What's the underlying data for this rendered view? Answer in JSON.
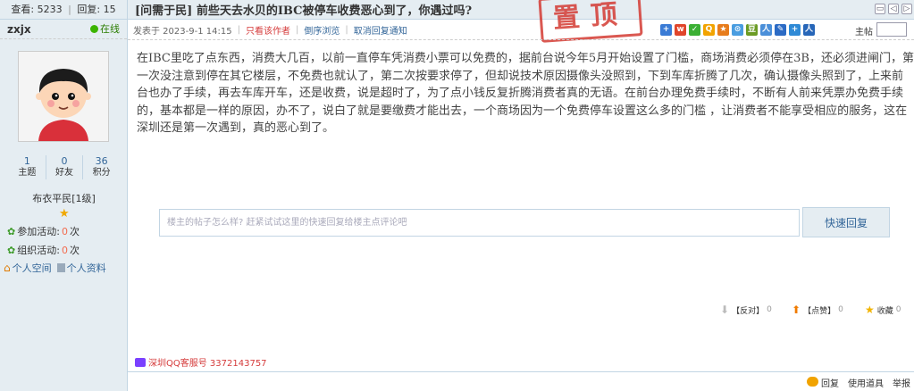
{
  "stats": {
    "views_label": "查看:",
    "views": "5233",
    "replies_label": "回复:",
    "replies": "15"
  },
  "author": {
    "name": "zxjx",
    "status": "在线"
  },
  "counts": [
    {
      "value": "1",
      "label": "主题"
    },
    {
      "value": "0",
      "label": "好友"
    },
    {
      "value": "36",
      "label": "积分"
    }
  ],
  "rank": "布衣平民[1级]",
  "activities": [
    {
      "label": "参加活动:",
      "count": "0",
      "unit": "次"
    },
    {
      "label": "组织活动:",
      "count": "0",
      "unit": "次"
    }
  ],
  "profile_links": {
    "space": "个人空间",
    "profile": "个人资料"
  },
  "post": {
    "title": "[问需于民] 前些天去水贝的IBC被停车收费恶心到了，你遇过吗?",
    "stamp": "置顶",
    "posted": "发表于 2023-9-1 14:15",
    "only_author": "只看该作者",
    "reverse": "倒序浏览",
    "cancel_notify": "取消回复通知",
    "font_label": "主帖",
    "body": "在IBC里吃了点东西，消费大几百，以前一直停车凭消费小票可以免费的，据前台说今年5月开始设置了门槛，商场消费必须停在3B，还必须进闸门，第一次没注意到停在其它楼层，不免费也就认了，第二次按要求停了，但却说技术原因摄像头没照到，下到车库折腾了几次，确认摄像头照到了，上来前台也办了手续，再去车库开车，还是收费，说是超时了，为了点小钱反复折腾消费者真的无语。在前台办理免费手续时，不断有人前来凭票办免费手续的，基本都是一样的原因，办不了，说白了就是要缴费才能出去，一个商场因为一个免费停车设置这么多的门槛 ，让消费者不能享受相应的服务，这在深圳还是第一次遇到，真的恶心到了。"
  },
  "quick_reply": {
    "placeholder": "楼主的帖子怎么样? 赶紧试试这里的快速回复给楼主点评论吧",
    "button": "快速回复"
  },
  "actions": {
    "oppose": {
      "label": "【反对】",
      "count": "0"
    },
    "support": {
      "label": "【点赞】",
      "count": "0"
    },
    "favorite": {
      "label": "收藏",
      "count": "0"
    }
  },
  "qq_service": "深圳QQ客服号 3372143757",
  "bottom": {
    "reply": "回复",
    "tools": "使用道具",
    "report": "举报"
  },
  "colors": {
    "accent": "#336699",
    "stamp": "#d5413a",
    "panel": "#e5edf2"
  }
}
